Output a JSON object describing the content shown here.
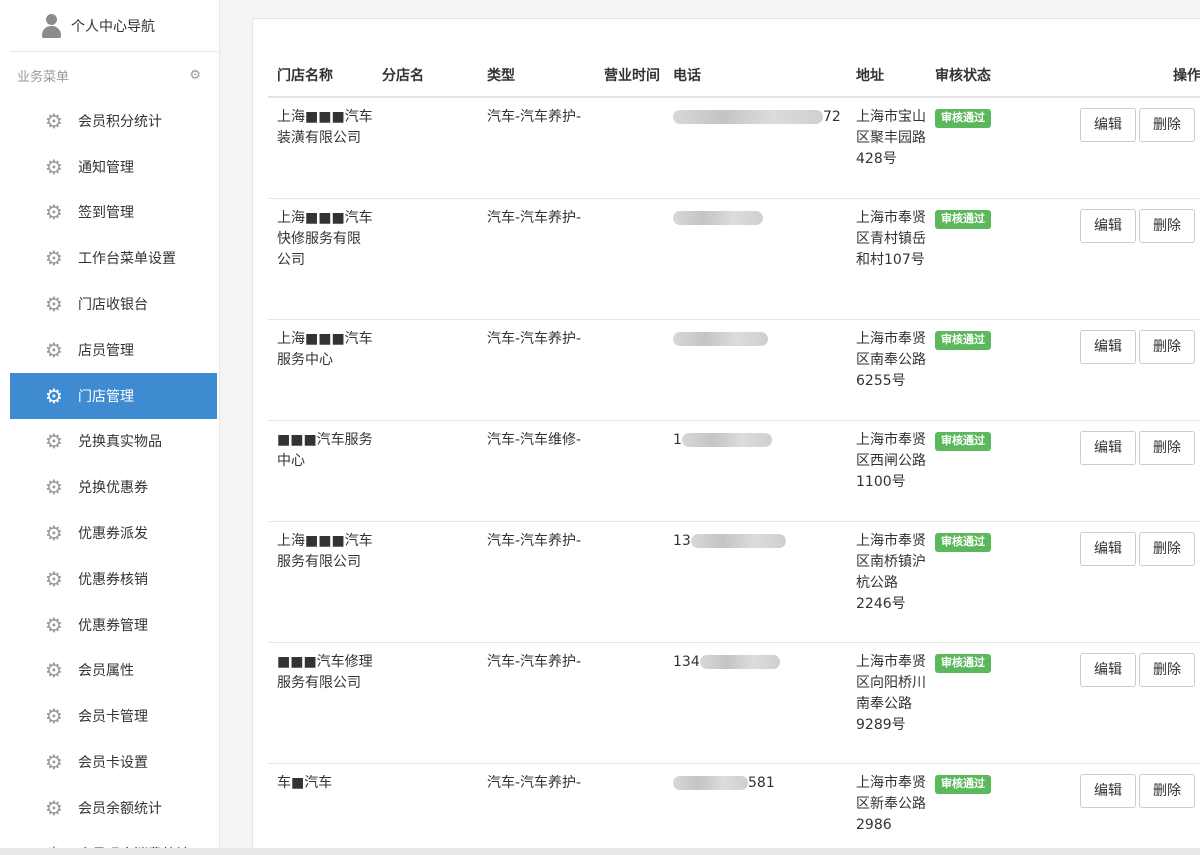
{
  "sidebar": {
    "top_label": "个人中心导航",
    "section_label": "业务菜单",
    "items": [
      {
        "label": "会员积分统计",
        "active": false
      },
      {
        "label": "通知管理",
        "active": false
      },
      {
        "label": "签到管理",
        "active": false
      },
      {
        "label": "工作台菜单设置",
        "active": false
      },
      {
        "label": "门店收银台",
        "active": false
      },
      {
        "label": "店员管理",
        "active": false
      },
      {
        "label": "门店管理",
        "active": true
      },
      {
        "label": "兑换真实物品",
        "active": false
      },
      {
        "label": "兑换优惠券",
        "active": false
      },
      {
        "label": "优惠券派发",
        "active": false
      },
      {
        "label": "优惠券核销",
        "active": false
      },
      {
        "label": "优惠券管理",
        "active": false
      },
      {
        "label": "会员属性",
        "active": false
      },
      {
        "label": "会员卡管理",
        "active": false
      },
      {
        "label": "会员卡设置",
        "active": false
      },
      {
        "label": "会员余额统计",
        "active": false
      },
      {
        "label": "会员现金消费统计",
        "active": false
      }
    ]
  },
  "table": {
    "headers": {
      "name": "门店名称",
      "branch": "分店名",
      "type": "类型",
      "hours": "营业时间",
      "phone": "电话",
      "address": "地址",
      "status": "审核状态",
      "ops": "操作"
    },
    "edit_label": "编辑",
    "delete_label": "删除",
    "rows": [
      {
        "name": "上海■■■汽车装潢有限公司",
        "branch": "",
        "type": "汽车-汽车养护-",
        "hours": "",
        "phone_prefix": "",
        "phone_suffix": "72",
        "address": "上海市宝山区聚丰园路428号",
        "status": "审核通过"
      },
      {
        "name": "上海■■■汽车快修服务有限公司",
        "branch": "",
        "type": "汽车-汽车养护-",
        "hours": "",
        "phone_prefix": "",
        "phone_suffix": "",
        "address": "上海市奉贤区青村镇岳和村107号",
        "status": "审核通过"
      },
      {
        "name": "上海■■■汽车服务中心",
        "branch": "",
        "type": "汽车-汽车养护-",
        "hours": "",
        "phone_prefix": "",
        "phone_suffix": "",
        "address": "上海市奉贤区南奉公路6255号",
        "status": "审核通过"
      },
      {
        "name": "■■■汽车服务中心",
        "branch": "",
        "type": "汽车-汽车维修-",
        "hours": "",
        "phone_prefix": "1",
        "phone_suffix": "",
        "address": "上海市奉贤区西闸公路1100号",
        "status": "审核通过"
      },
      {
        "name": "上海■■■汽车服务有限公司",
        "branch": "",
        "type": "汽车-汽车养护-",
        "hours": "",
        "phone_prefix": "13",
        "phone_suffix": "",
        "address": "上海市奉贤区南桥镇沪杭公路2246号",
        "status": "审核通过"
      },
      {
        "name": "■■■汽车修理服务有限公司",
        "branch": "",
        "type": "汽车-汽车养护-",
        "hours": "",
        "phone_prefix": "134",
        "phone_suffix": "",
        "address": "上海市奉贤区向阳桥川南奉公路9289号",
        "status": "审核通过"
      },
      {
        "name": "车■汽车",
        "branch": "",
        "type": "汽车-汽车养护-",
        "hours": "",
        "phone_prefix": "",
        "phone_suffix": "581",
        "address": "上海市奉贤区新奉公路2986",
        "status": "审核通过"
      }
    ]
  }
}
